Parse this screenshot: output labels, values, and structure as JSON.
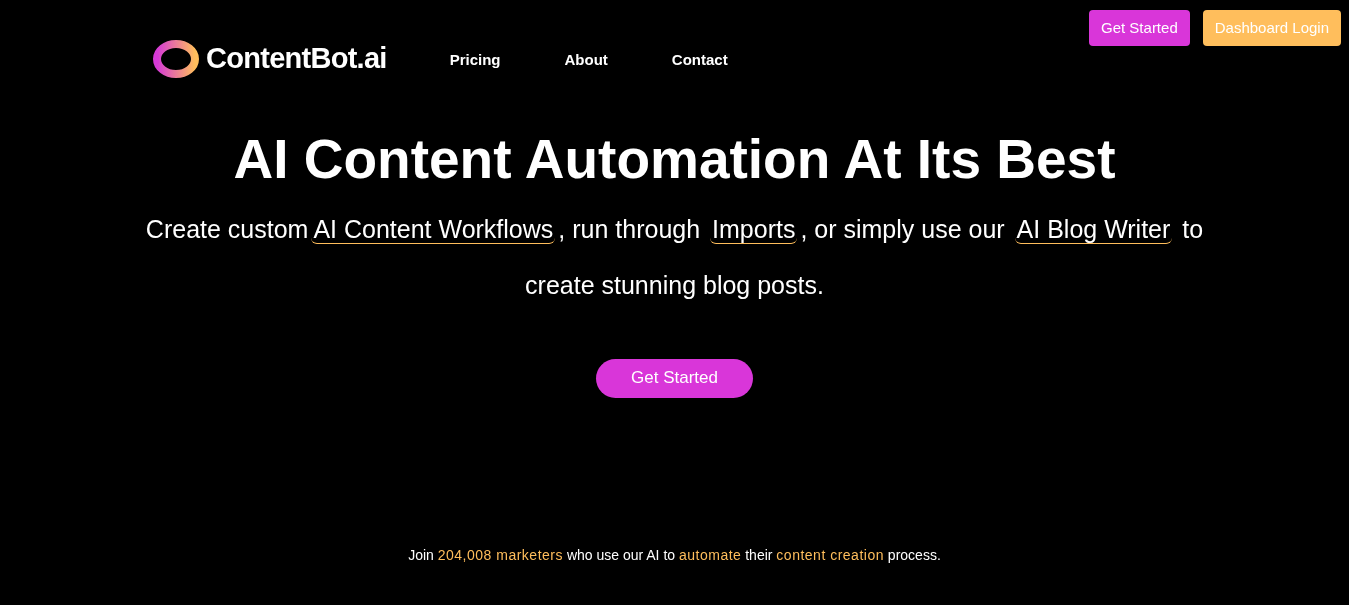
{
  "header_buttons": [
    {
      "label": "Get Started",
      "kind": "primary"
    },
    {
      "label": "Dashboard Login",
      "kind": "secondary"
    }
  ],
  "logo": {
    "text": "ContentBot.ai"
  },
  "nav": [
    "Pricing",
    "About",
    "Contact"
  ],
  "hero": {
    "title": "AI Content Automation At Its Best",
    "subtitle": [
      {
        "text": "Create custom",
        "kind": "plain"
      },
      {
        "text": "AI Content Workflows",
        "kind": "link"
      },
      {
        "text": ", run through ",
        "kind": "plain"
      },
      {
        "text": "Imports",
        "kind": "link"
      },
      {
        "text": ", or simply use our ",
        "kind": "plain"
      },
      {
        "text": "AI Blog Writer",
        "kind": "link"
      },
      {
        "text": " to create stunning blog posts.",
        "kind": "plain"
      }
    ],
    "button": "Get Started"
  },
  "footer_line": [
    {
      "text": "Join ",
      "highlight": false
    },
    {
      "text": "204,008 marketers",
      "highlight": true
    },
    {
      "text": " who use our AI to ",
      "highlight": false
    },
    {
      "text": "automate",
      "highlight": true
    },
    {
      "text": " their ",
      "highlight": false
    },
    {
      "text": "content creation",
      "highlight": true
    },
    {
      "text": " process.",
      "highlight": false
    }
  ]
}
